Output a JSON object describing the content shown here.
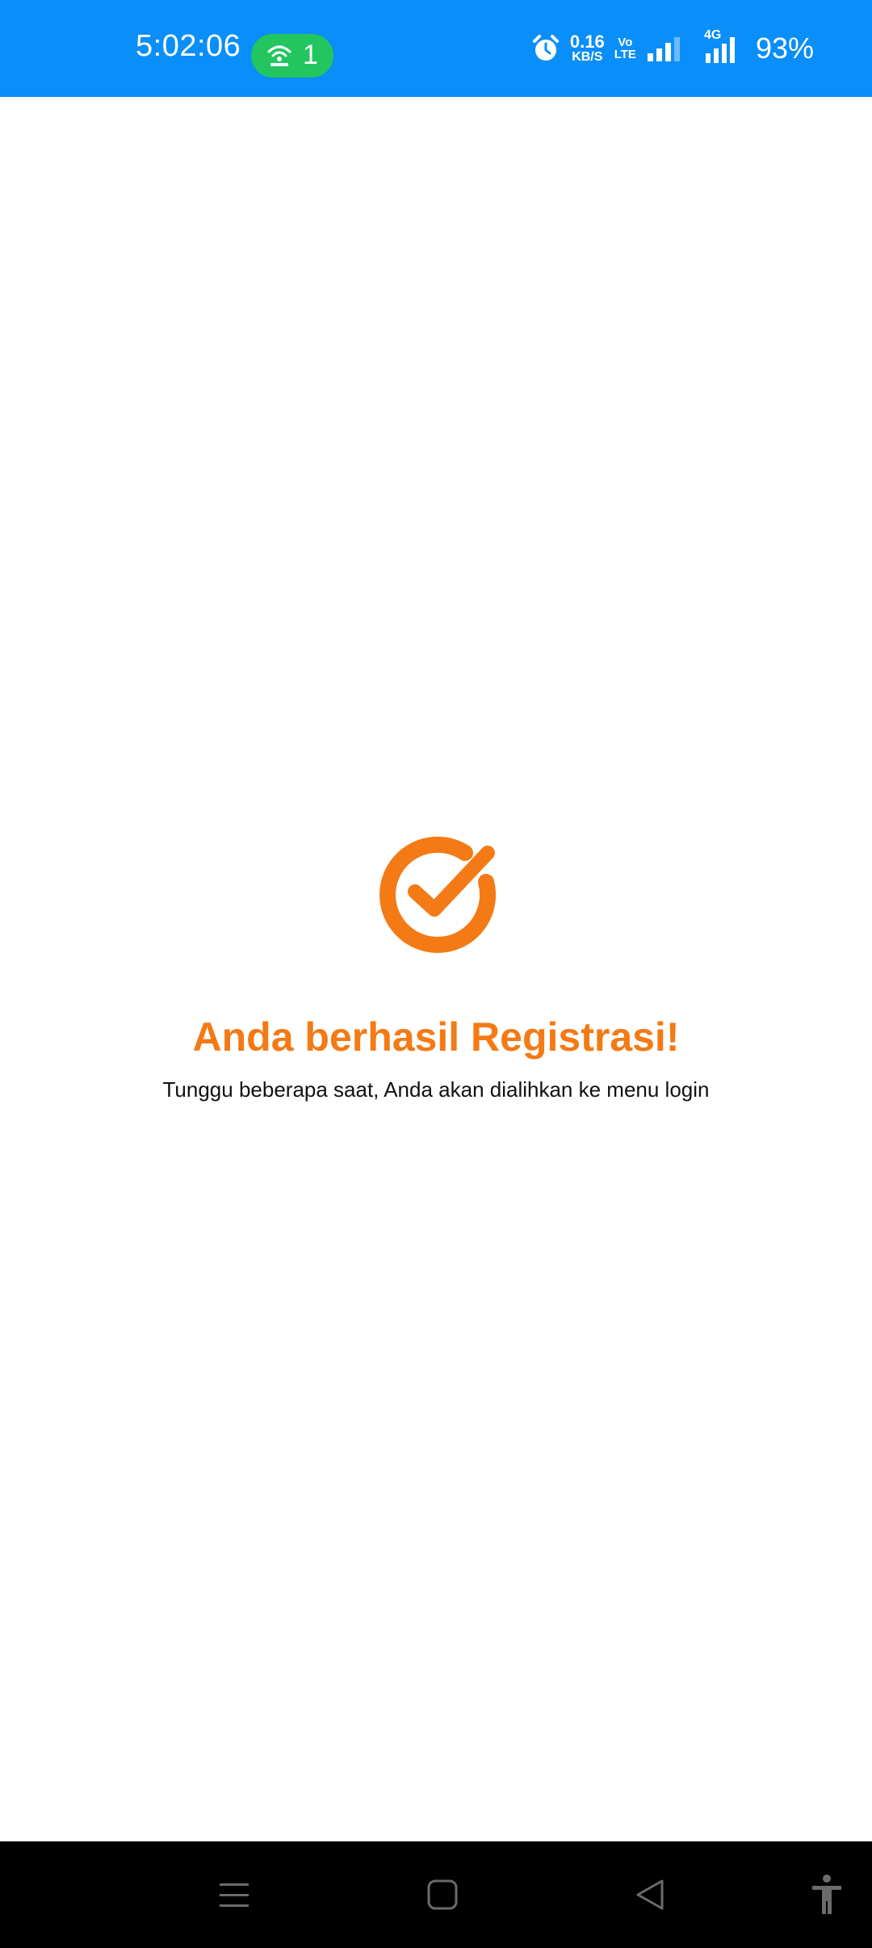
{
  "status_bar": {
    "time": "5:02:06",
    "hotspot_count": "1",
    "net_speed_value": "0.16",
    "net_speed_unit": "KB/S",
    "volte_top": "Vo",
    "volte_bottom": "LTE",
    "network_type": "4G",
    "battery": "93%",
    "colors": {
      "background": "#0a8ef9",
      "hotspot_pill": "#22c55e"
    },
    "icons": [
      "hotspot-icon",
      "alarm-icon",
      "signal-sim1-icon",
      "signal-sim2-icon"
    ]
  },
  "success": {
    "icon": "check-circle-icon",
    "title": "Anda berhasil Registrasi!",
    "subtitle": "Tunggu beberapa saat, Anda akan dialihkan ke menu login",
    "accent_color": "#f47a15"
  },
  "nav_bar": {
    "buttons": [
      "menu-icon",
      "home-icon",
      "back-icon",
      "accessibility-icon"
    ]
  }
}
